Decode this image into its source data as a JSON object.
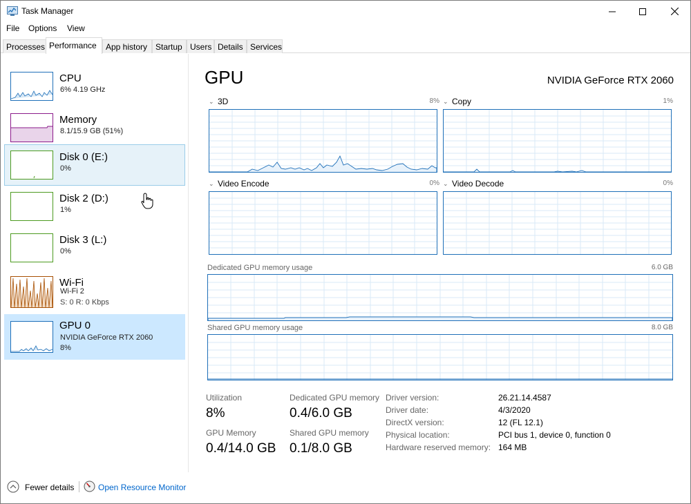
{
  "window": {
    "title": "Task Manager"
  },
  "menu": [
    "File",
    "Options",
    "View"
  ],
  "tabs": [
    {
      "label": "Processes",
      "active": false
    },
    {
      "label": "Performance",
      "active": true
    },
    {
      "label": "App history",
      "active": false
    },
    {
      "label": "Startup",
      "active": false
    },
    {
      "label": "Users",
      "active": false
    },
    {
      "label": "Details",
      "active": false
    },
    {
      "label": "Services",
      "active": false
    }
  ],
  "sidebar": {
    "items": [
      {
        "name": "CPU",
        "line1": "6%  4.19 GHz",
        "line2": "",
        "color": "#1e6fb8",
        "state": "normal"
      },
      {
        "name": "Memory",
        "line1": "8.1/15.9 GB (51%)",
        "line2": "",
        "color": "#8b1a8b",
        "state": "normal"
      },
      {
        "name": "Disk 0 (E:)",
        "line1": "0%",
        "line2": "",
        "color": "#4c9a1f",
        "state": "hover"
      },
      {
        "name": "Disk 2 (D:)",
        "line1": "1%",
        "line2": "",
        "color": "#4c9a1f",
        "state": "normal"
      },
      {
        "name": "Disk 3 (L:)",
        "line1": "0%",
        "line2": "",
        "color": "#4c9a1f",
        "state": "normal"
      },
      {
        "name": "Wi-Fi",
        "line1": "Wi-Fi 2",
        "line2": "S: 0  R: 0 Kbps",
        "color": "#a74f01",
        "state": "normal"
      },
      {
        "name": "GPU 0",
        "line1": "NVIDIA GeForce RTX 2060",
        "line2": "8%",
        "color": "#1e6fb8",
        "state": "selected"
      }
    ]
  },
  "main": {
    "title": "GPU",
    "model": "NVIDIA GeForce RTX 2060",
    "engines": [
      {
        "label": "3D",
        "pct": "8%"
      },
      {
        "label": "Copy",
        "pct": "1%"
      },
      {
        "label": "Video Encode",
        "pct": "0%"
      },
      {
        "label": "Video Decode",
        "pct": "0%"
      }
    ],
    "dedicated": {
      "label": "Dedicated GPU memory usage",
      "max": "6.0 GB"
    },
    "shared": {
      "label": "Shared GPU memory usage",
      "max": "8.0 GB"
    },
    "stats": {
      "utilization_label": "Utilization",
      "utilization": "8%",
      "dedicated_label": "Dedicated GPU memory",
      "dedicated": "0.4/6.0 GB",
      "gpu_memory_label": "GPU Memory",
      "gpu_memory": "0.4/14.0 GB",
      "shared_label": "Shared GPU memory",
      "shared": "0.1/8.0 GB"
    },
    "info": [
      {
        "label": "Driver version:",
        "value": "26.21.14.4587"
      },
      {
        "label": "Driver date:",
        "value": "4/3/2020"
      },
      {
        "label": "DirectX version:",
        "value": "12 (FL 12.1)"
      },
      {
        "label": "Physical location:",
        "value": "PCI bus 1, device 0, function 0"
      },
      {
        "label": "Hardware reserved memory:",
        "value": "164 MB"
      }
    ]
  },
  "footer": {
    "fewer_details": "Fewer details",
    "resource_monitor": "Open Resource Monitor"
  },
  "colors": {
    "gpu_line": "#1e6fb8",
    "selected_bg": "#cce8ff",
    "hover_bg": "#e6f2f9",
    "link": "#0066cc"
  }
}
